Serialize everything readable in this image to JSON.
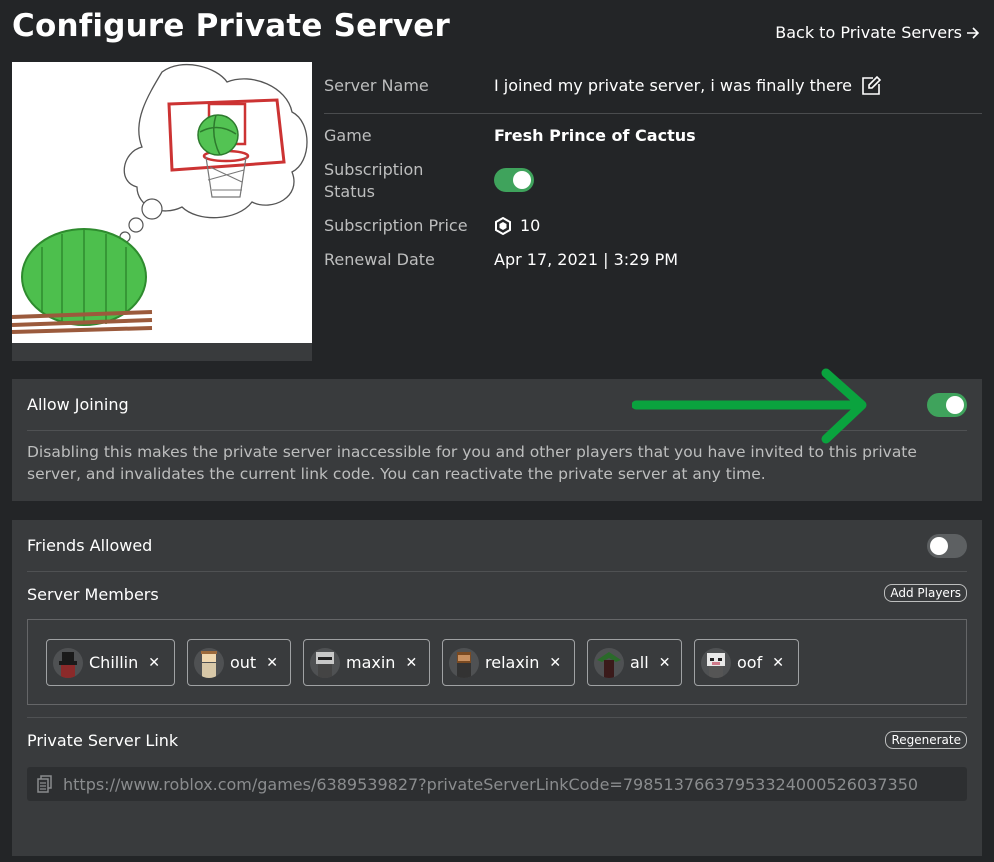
{
  "page": {
    "title": "Configure Private Server",
    "back_link": "Back to Private Servers"
  },
  "info": {
    "server_name_label": "Server Name",
    "server_name_value": "I joined my private server, i was finally there",
    "game_label": "Game",
    "game_value": "Fresh Prince of Cactus",
    "subscription_status_label": "Subscription Status",
    "subscription_status_on": true,
    "subscription_price_label": "Subscription Price",
    "subscription_price_value": "10",
    "renewal_date_label": "Renewal Date",
    "renewal_date_value": "Apr 17, 2021 | 3:29 PM"
  },
  "allow_joining": {
    "label": "Allow Joining",
    "enabled": true,
    "description": "Disabling this makes the private server inaccessible for you and other players that you have invited to this private server, and invalidates the current link code. You can reactivate the private server at any time."
  },
  "friends_allowed": {
    "label": "Friends Allowed",
    "enabled": false
  },
  "server_members": {
    "label": "Server Members",
    "add_button": "Add Players",
    "members": [
      {
        "name": "Chillin"
      },
      {
        "name": "out"
      },
      {
        "name": "maxin"
      },
      {
        "name": "relaxin"
      },
      {
        "name": "all"
      },
      {
        "name": "oof"
      }
    ]
  },
  "private_link": {
    "label": "Private Server Link",
    "regenerate_button": "Regenerate",
    "url": "https://www.roblox.com/games/6389539827?privateServerLinkCode=79851376637953324000526037350"
  },
  "colors": {
    "background": "#232527",
    "panel": "#393b3d",
    "toggle_on": "#3fa35c",
    "toggle_off": "#5d6062",
    "annotation_arrow": "#0aa33e"
  },
  "icons": {
    "back": "arrow-right-icon",
    "edit": "edit-icon",
    "robux": "robux-icon",
    "remove": "close-icon",
    "copy": "copy-icon"
  }
}
